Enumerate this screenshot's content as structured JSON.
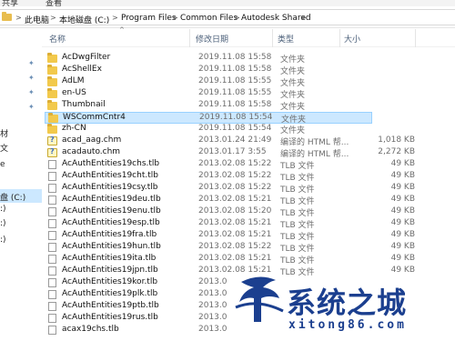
{
  "menubar": {
    "share": "共享",
    "view": "查看"
  },
  "breadcrumb": {
    "items": [
      "此电脑",
      "本地磁盘 (C:)",
      "Program Files",
      "Common Files",
      "Autodesk Shared"
    ],
    "separator": ">"
  },
  "nav": {
    "labels": [
      "材",
      "文",
      "e",
      "盘 (C:)",
      ":)",
      ":)",
      ":)"
    ],
    "pin_glyph": "✦"
  },
  "columns": {
    "name": "名称",
    "modified": "修改日期",
    "type": "类型",
    "size": "大小",
    "sort_caret": "^"
  },
  "files": [
    {
      "icon": "folder",
      "name": "AcDwgFilter",
      "modified": "2019.11.08 15:58",
      "type": "文件夹",
      "size": ""
    },
    {
      "icon": "folder",
      "name": "AcShellEx",
      "modified": "2019.11.08 15:58",
      "type": "文件夹",
      "size": ""
    },
    {
      "icon": "folder",
      "name": "AdLM",
      "modified": "2019.11.08 15:55",
      "type": "文件夹",
      "size": ""
    },
    {
      "icon": "folder",
      "name": "en-US",
      "modified": "2019.11.08 15:55",
      "type": "文件夹",
      "size": ""
    },
    {
      "icon": "folder",
      "name": "Thumbnail",
      "modified": "2019.11.08 15:58",
      "type": "文件夹",
      "size": ""
    },
    {
      "icon": "folder",
      "name": "WSCommCntr4",
      "modified": "2019.11.08 15:54",
      "type": "文件夹",
      "size": "",
      "selected": true
    },
    {
      "icon": "folder",
      "name": "zh-CN",
      "modified": "2019.11.08 15:54",
      "type": "文件夹",
      "size": ""
    },
    {
      "icon": "chm",
      "name": "acad_aag.chm",
      "modified": "2013.01.24 21:49",
      "type": "编译的 HTML 帮...",
      "size": "1,018 KB"
    },
    {
      "icon": "chm",
      "name": "acadauto.chm",
      "modified": "2013.01.17 3:55",
      "type": "编译的 HTML 帮...",
      "size": "2,272 KB"
    },
    {
      "icon": "file",
      "name": "AcAuthEntities19chs.tlb",
      "modified": "2013.02.08 15:22",
      "type": "TLB 文件",
      "size": "49 KB"
    },
    {
      "icon": "file",
      "name": "AcAuthEntities19cht.tlb",
      "modified": "2013.02.08 15:22",
      "type": "TLB 文件",
      "size": "49 KB"
    },
    {
      "icon": "file",
      "name": "AcAuthEntities19csy.tlb",
      "modified": "2013.02.08 15:22",
      "type": "TLB 文件",
      "size": "49 KB"
    },
    {
      "icon": "file",
      "name": "AcAuthEntities19deu.tlb",
      "modified": "2013.02.08 15:21",
      "type": "TLB 文件",
      "size": "49 KB"
    },
    {
      "icon": "file",
      "name": "AcAuthEntities19enu.tlb",
      "modified": "2013.02.08 15:20",
      "type": "TLB 文件",
      "size": "49 KB"
    },
    {
      "icon": "file",
      "name": "AcAuthEntities19esp.tlb",
      "modified": "2013.02.08 15:21",
      "type": "TLB 文件",
      "size": "49 KB"
    },
    {
      "icon": "file",
      "name": "AcAuthEntities19fra.tlb",
      "modified": "2013.02.08 15:21",
      "type": "TLB 文件",
      "size": "49 KB"
    },
    {
      "icon": "file",
      "name": "AcAuthEntities19hun.tlb",
      "modified": "2013.02.08 15:22",
      "type": "TLB 文件",
      "size": "49 KB"
    },
    {
      "icon": "file",
      "name": "AcAuthEntities19ita.tlb",
      "modified": "2013.02.08 15:21",
      "type": "TLB 文件",
      "size": "49 KB"
    },
    {
      "icon": "file",
      "name": "AcAuthEntities19jpn.tlb",
      "modified": "2013.02.08 15:21",
      "type": "TLB 文件",
      "size": "49 KB"
    },
    {
      "icon": "file",
      "name": "AcAuthEntities19kor.tlb",
      "modified": "2013.0",
      "type": "",
      "size": ""
    },
    {
      "icon": "file",
      "name": "AcAuthEntities19plk.tlb",
      "modified": "2013.0",
      "type": "",
      "size": ""
    },
    {
      "icon": "file",
      "name": "AcAuthEntities19ptb.tlb",
      "modified": "2013.0",
      "type": "",
      "size": ""
    },
    {
      "icon": "file",
      "name": "AcAuthEntities19rus.tlb",
      "modified": "2013.0",
      "type": "",
      "size": ""
    },
    {
      "icon": "file",
      "name": "acax19chs.tlb",
      "modified": "2013.0",
      "type": "",
      "size": ""
    }
  ],
  "watermark": {
    "title": "系统之城",
    "url": "xitong86.com"
  },
  "colors": {
    "selection": "#cce8ff",
    "selection_border": "#99d1ff",
    "folder": "#f2c94c",
    "watermark": "#1b3f8f"
  }
}
